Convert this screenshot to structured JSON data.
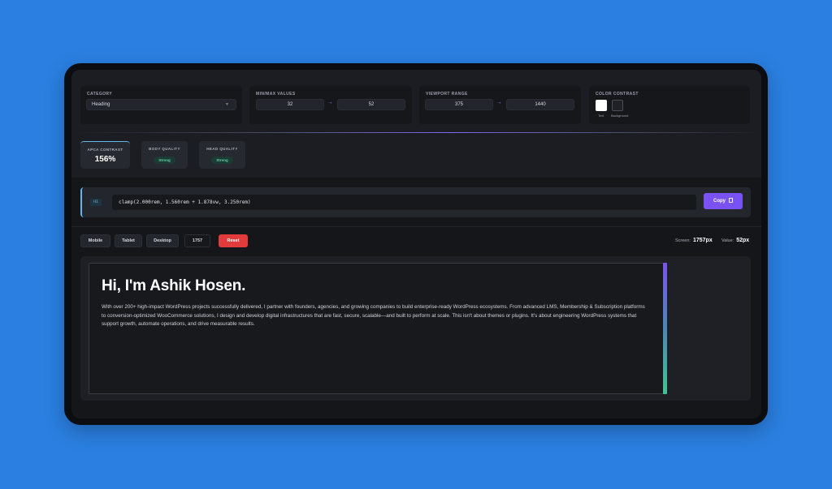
{
  "controls": {
    "category": {
      "label": "CATEGORY",
      "value": "Heading",
      "chevron": "chevron-down-icon"
    },
    "minmax": {
      "label": "MIN/MAX VALUES",
      "min": "32",
      "max": "52",
      "arrow": "→"
    },
    "viewport": {
      "label": "VIEWPORT RANGE",
      "min": "375",
      "max": "1440",
      "arrow": "→"
    },
    "contrast": {
      "label": "COLOR CONTRAST",
      "text_label": "Text",
      "bg_label": "Background",
      "text_color": "#ffffff",
      "bg_color": "#1f2126"
    }
  },
  "metrics": [
    {
      "label": "APCA CONTRAST",
      "value": "156%"
    },
    {
      "label": "BODY QUALITY",
      "value": "Strong"
    },
    {
      "label": "HEAD QUALITY",
      "value": "Strong"
    }
  ],
  "clamp": {
    "tag": "H1",
    "code": "clamp(2.000rem, 1.560rem + 1.878vw, 3.250rem)",
    "copy_label": "Copy"
  },
  "toolbar": {
    "mobile": "Mobile",
    "tablet": "Tablet",
    "desktop": "Desktop",
    "width_value": "1757",
    "reset": "Reset",
    "screen_label": "Screen:",
    "screen_value": "1757px",
    "value_label": "Value:",
    "value_value": "52px"
  },
  "preview": {
    "title": "Hi, I'm Ashik Hosen.",
    "body": "With over 200+ high-impact WordPress projects successfully delivered, I partner with founders, agencies, and growing companies to build enterprise-ready WordPress ecosystems. From advanced LMS, Membership & Subscription platforms to conversion-optimized WooCommerce solutions, I design and develop digital infrastructures that are fast, secure, scalable—and built to perform at scale. This isn't about themes or plugins. It's about engineering WordPress systems that support growth, automate operations, and drive measurable results."
  },
  "colors": {
    "accent": "#7b52f2",
    "reset": "#e23b3b",
    "strong_badge": "#5fd3a6",
    "page_bg": "#2a7fe0"
  }
}
